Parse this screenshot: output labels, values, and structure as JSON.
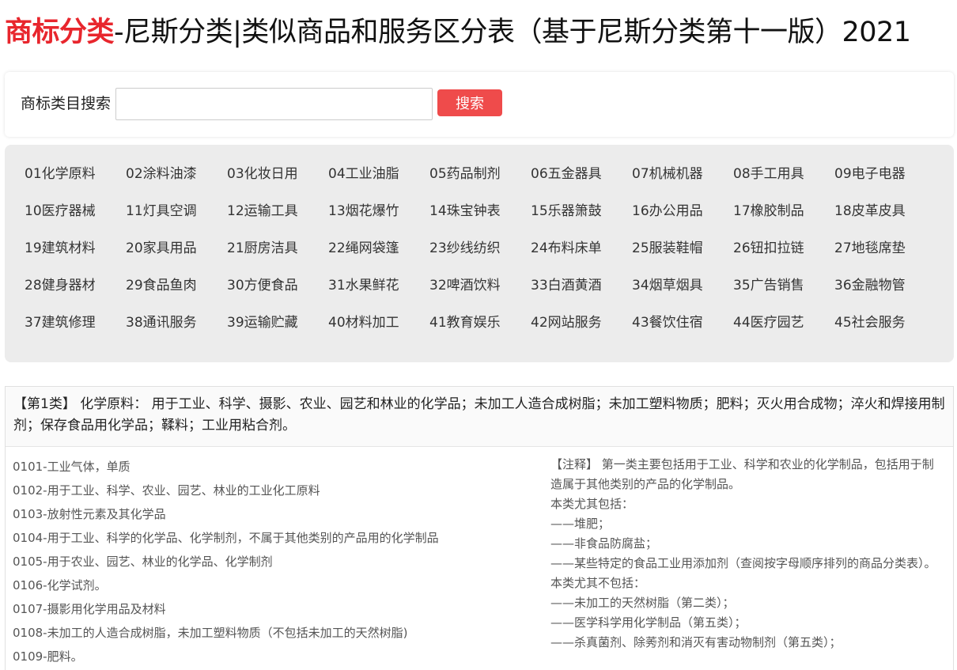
{
  "header": {
    "brand": "商标分类",
    "title_rest": "-尼斯分类|类似商品和服务区分表（基于尼斯分类第十一版）2021"
  },
  "search": {
    "label": "商标类目搜索",
    "value": "",
    "placeholder": "",
    "button_label": "搜索"
  },
  "classes": [
    "01化学原料",
    "02涂料油漆",
    "03化妆日用",
    "04工业油脂",
    "05药品制剂",
    "06五金器具",
    "07机械机器",
    "08手工用具",
    "09电子电器",
    "10医疗器械",
    "11灯具空调",
    "12运输工具",
    "13烟花爆竹",
    "14珠宝钟表",
    "15乐器箫鼓",
    "16办公用品",
    "17橡胶制品",
    "18皮革皮具",
    "19建筑材料",
    "20家具用品",
    "21厨房洁具",
    "22绳网袋篷",
    "23纱线纺织",
    "24布料床单",
    "25服装鞋帽",
    "26钮扣拉链",
    "27地毯席垫",
    "28健身器材",
    "29食品鱼肉",
    "30方便食品",
    "31水果鲜花",
    "32啤酒饮料",
    "33白酒黄酒",
    "34烟草烟具",
    "35广告销售",
    "36金融物管",
    "37建筑修理",
    "38通讯服务",
    "39运输贮藏",
    "40材料加工",
    "41教育娱乐",
    "42网站服务",
    "43餐饮住宿",
    "44医疗园艺",
    "45社会服务"
  ],
  "detail": {
    "header_text": "【第1类】 化学原料： 用于工业、科学、摄影、农业、园艺和林业的化学品；未加工人造合成树脂；未加工塑料物质；肥料；灭火用合成物；淬火和焊接用制剂；保存食品用化学品；鞣料；工业用粘合剂。",
    "items": [
      "0101-工业气体，单质",
      "0102-用于工业、科学、农业、园艺、林业的工业化工原料",
      "0103-放射性元素及其化学品",
      "0104-用于工业、科学的化学品、化学制剂，不属于其他类别的产品用的化学制品",
      "0105-用于农业、园艺、林业的化学品、化学制剂",
      "0106-化学试剂。",
      "0107-摄影用化学用品及材料",
      "0108-未加工的人造合成树脂，未加工塑料物质（不包括未加工的天然树脂)",
      "0109-肥料。"
    ],
    "notes": [
      "【注释】 第一类主要包括用于工业、科学和农业的化学制品，包括用于制造属于其他类别的产品的化学制品。",
      "本类尤其包括：",
      "——堆肥；",
      "——非食品防腐盐；",
      "——某些特定的食品工业用添加剂（查阅按字母顺序排列的商品分类表）。",
      "本类尤其不包括：",
      "——未加工的天然树脂（第二类）；",
      "——医学科学用化学制品（第五类）；",
      "——杀真菌剂、除莠剂和消灭有害动物制剂（第五类）；"
    ]
  }
}
